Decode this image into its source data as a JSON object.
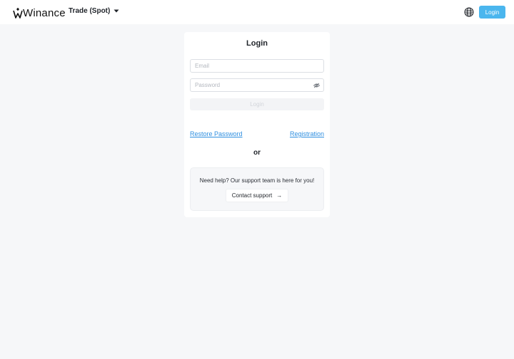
{
  "header": {
    "logo_text": "Winance",
    "trade_menu_label": "Trade (Spot)",
    "login_label": "Login"
  },
  "icons": {
    "logo": "winance-crown-icon",
    "trade_caret": "caret-down-icon",
    "language": "globe-icon",
    "password_toggle": "eye-slash-icon",
    "contact_arrow": "arrow-right-icon"
  },
  "colors": {
    "accent": "#4ab6ee",
    "link": "#2f8fe0",
    "background": "#f6f7f9",
    "card": "#ffffff"
  },
  "login_form": {
    "title": "Login",
    "email_placeholder": "Email",
    "email_value": "",
    "password_placeholder": "Password",
    "password_value": "",
    "submit_label": "Login",
    "restore_password_label": "Restore Password",
    "registration_label": "Registration",
    "or_label": "or"
  },
  "support": {
    "text": "Need help? Our support team is here for you!",
    "button_label": "Contact support",
    "arrow": "→"
  }
}
